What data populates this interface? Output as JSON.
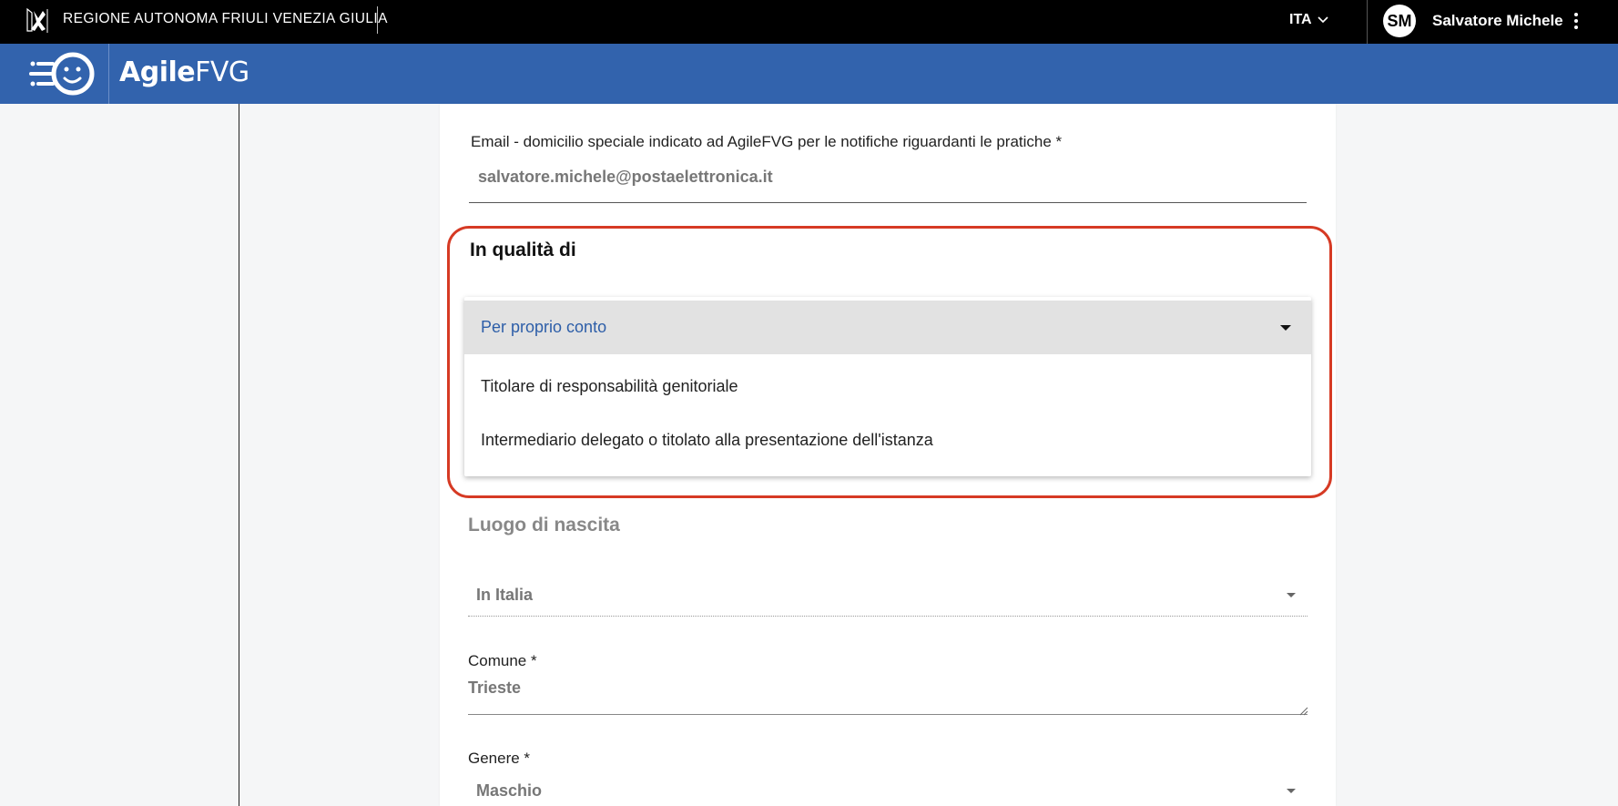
{
  "topbar": {
    "region_name": "REGIONE AUTONOMA FRIULI VENEZIA GIULIA",
    "language": "ITA",
    "avatar_initials": "SM",
    "user_name": "Salvatore Michele"
  },
  "appbar": {
    "title_bold": "Agile",
    "title_light": "FVG"
  },
  "form": {
    "email_label": "Email - domicilio speciale indicato ad AgileFVG per le notifiche riguardanti le pratiche *",
    "email_value": "salvatore.michele@postaelettronica.it",
    "qualita_title": "In qualità di",
    "qualita_options": [
      "Per proprio conto",
      "Titolare di responsabilità genitoriale",
      "Intermediario delegato o titolato alla presentazione dell'istanza"
    ],
    "luogo_title": "Luogo di nascita",
    "luogo_value": "In Italia",
    "comune_label": "Comune *",
    "comune_value": "Trieste",
    "genere_label": "Genere *",
    "genere_value": "Maschio"
  },
  "colors": {
    "topbar": "#000000",
    "appbar": "#3263ad",
    "highlight": "#d63a24",
    "selected_text": "#2d5ea8"
  }
}
